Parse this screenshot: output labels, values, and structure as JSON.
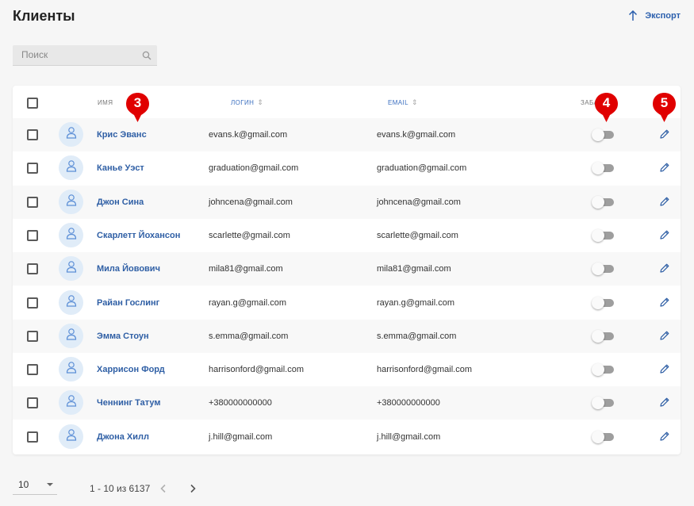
{
  "header": {
    "title": "Клиенты",
    "export_label": "Экспорт"
  },
  "search": {
    "placeholder": "Поиск"
  },
  "table": {
    "columns": {
      "name": "ИМЯ",
      "login": "ЛОГИН",
      "email": "EMAIL",
      "blocked": "ЗАБАНЕН"
    },
    "rows": [
      {
        "name": "Крис Эванс",
        "login": "evans.k@gmail.com",
        "email": "evans.k@gmail.com",
        "blocked": false
      },
      {
        "name": "Канье Уэст",
        "login": "graduation@gmail.com",
        "email": "graduation@gmail.com",
        "blocked": false
      },
      {
        "name": "Джон Сина",
        "login": "johncena@gmail.com",
        "email": "johncena@gmail.com",
        "blocked": false
      },
      {
        "name": "Скарлетт Йохансон",
        "login": "scarlette@gmail.com",
        "email": "scarlette@gmail.com",
        "blocked": false
      },
      {
        "name": "Мила Йовович",
        "login": "mila81@gmail.com",
        "email": "mila81@gmail.com",
        "blocked": false
      },
      {
        "name": "Райан Гослинг",
        "login": "rayan.g@gmail.com",
        "email": "rayan.g@gmail.com",
        "blocked": false
      },
      {
        "name": "Эмма Стоун",
        "login": "s.emma@gmail.com",
        "email": "s.emma@gmail.com",
        "blocked": false
      },
      {
        "name": "Харрисон Форд",
        "login": "harrisonford@gmail.com",
        "email": "harrisonford@gmail.com",
        "blocked": false
      },
      {
        "name": "Ченнинг Татум",
        "login": "+380000000000",
        "email": "+380000000000",
        "blocked": false
      },
      {
        "name": "Джона Хилл",
        "login": "j.hill@gmail.com",
        "email": "j.hill@gmail.com",
        "blocked": false
      }
    ]
  },
  "markers": [
    "3",
    "4",
    "5"
  ],
  "pagination": {
    "page_size": "10",
    "range_text": "1 - 10 из 6137"
  },
  "colors": {
    "accent": "#2f5fa5",
    "marker": "#e00000",
    "toggle_off": "#9e9e9e",
    "avatar_bg": "#e0ecf8"
  },
  "icons": {
    "export": "arrow-up-icon",
    "search": "search-icon",
    "avatar": "user-icon",
    "edit": "pencil-icon",
    "prev": "chevron-left-icon",
    "next": "chevron-right-icon"
  }
}
